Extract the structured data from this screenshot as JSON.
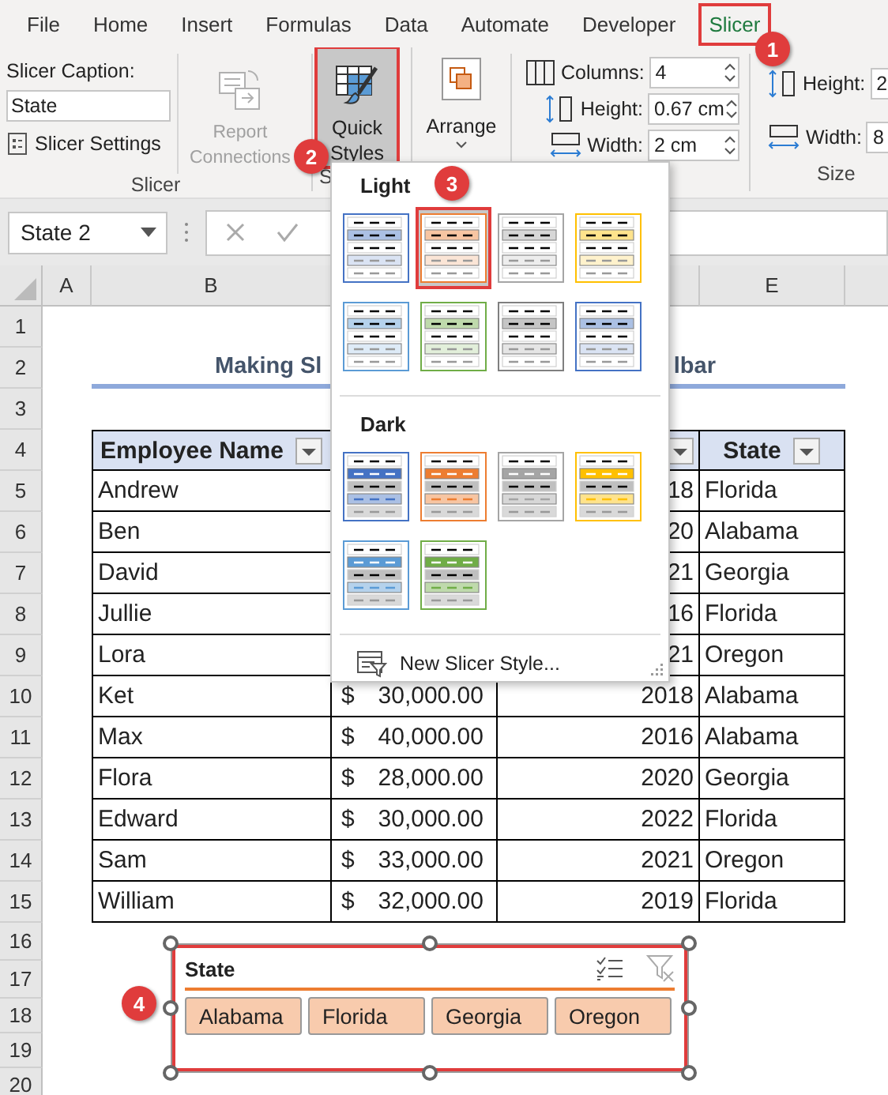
{
  "tabs": [
    {
      "label": "File",
      "selected": false,
      "highlighted": false
    },
    {
      "label": "Home",
      "selected": false,
      "highlighted": false
    },
    {
      "label": "Insert",
      "selected": false,
      "highlighted": false
    },
    {
      "label": "Formulas",
      "selected": false,
      "highlighted": false
    },
    {
      "label": "Data",
      "selected": false,
      "highlighted": false
    },
    {
      "label": "Automate",
      "selected": false,
      "highlighted": false
    },
    {
      "label": "Developer",
      "selected": false,
      "highlighted": false
    },
    {
      "label": "Slicer",
      "selected": true,
      "highlighted": true
    }
  ],
  "ribbon": {
    "slicer_group": {
      "caption_label": "Slicer Caption:",
      "caption_value": "State",
      "settings_button": "Slicer Settings",
      "report_button": {
        "lines": [
          "Report",
          "Connections"
        ],
        "disabled": true
      },
      "group_label": "Slicer"
    },
    "styles_group": {
      "quick_styles": {
        "lines": [
          "Quick",
          "Styles"
        ],
        "pressed": true,
        "highlighted": true
      },
      "group_label": "S"
    },
    "arrange_button": {
      "label": "Arrange"
    },
    "fields": [
      {
        "kind": "columns",
        "label": "Columns:",
        "value": "4"
      },
      {
        "kind": "height",
        "label": "Height:",
        "value": "0.67 cm"
      },
      {
        "kind": "width",
        "label": "Width:",
        "value": "2 cm"
      }
    ],
    "size_group": {
      "fields": [
        {
          "kind": "height",
          "label": "Height:",
          "value": "2"
        },
        {
          "kind": "width",
          "label": "Width:",
          "value": "8"
        }
      ],
      "group_label": "Size"
    }
  },
  "formula_bar": {
    "name_box": "State 2"
  },
  "gallery": {
    "sections": [
      {
        "title": "Light",
        "styles": [
          {
            "kind": "light",
            "color": "#4472c4",
            "selected": false,
            "highlighted": false
          },
          {
            "kind": "light",
            "color": "#ed7d31",
            "selected": true,
            "highlighted": true
          },
          {
            "kind": "light",
            "color": "#a5a5a5",
            "selected": false,
            "highlighted": false
          },
          {
            "kind": "light",
            "color": "#ffc000",
            "selected": false,
            "highlighted": false
          },
          {
            "kind": "light",
            "color": "#5b9bd5",
            "selected": false,
            "highlighted": false
          },
          {
            "kind": "light",
            "color": "#70ad47",
            "selected": false,
            "highlighted": false
          },
          {
            "kind": "light",
            "color": "#7f7f7f",
            "selected": false,
            "highlighted": false
          },
          {
            "kind": "light",
            "color": "#4472c4",
            "selected": false,
            "highlighted": false
          }
        ]
      },
      {
        "title": "Dark",
        "styles": [
          {
            "kind": "dark",
            "color": "#4472c4",
            "selected": false,
            "highlighted": false
          },
          {
            "kind": "dark",
            "color": "#ed7d31",
            "selected": false,
            "highlighted": false
          },
          {
            "kind": "dark",
            "color": "#a5a5a5",
            "selected": false,
            "highlighted": false
          },
          {
            "kind": "dark",
            "color": "#ffc000",
            "selected": false,
            "highlighted": false
          },
          {
            "kind": "dark",
            "color": "#5b9bd5",
            "selected": false,
            "highlighted": false
          },
          {
            "kind": "dark",
            "color": "#70ad47",
            "selected": false,
            "highlighted": false
          }
        ]
      }
    ],
    "footer": "New Slicer Style..."
  },
  "sheet": {
    "column_headers": [
      "A",
      "B",
      "E"
    ],
    "row_numbers": [
      "1",
      "2",
      "3",
      "4",
      "5",
      "6",
      "7",
      "8",
      "9",
      "10",
      "11",
      "12",
      "13",
      "14",
      "15",
      "16",
      "17",
      "18",
      "19",
      "20"
    ],
    "title_left": "Making Sl",
    "title_right": "lbar",
    "table": {
      "columns": [
        {
          "label": "Employee Name",
          "filter": true
        },
        {},
        {
          "filter": true
        },
        {
          "label": "State",
          "filter": true
        }
      ],
      "rows": [
        {
          "name": "Andrew",
          "year": "18",
          "state": "Florida"
        },
        {
          "name": "Ben",
          "year": "20",
          "state": "Alabama"
        },
        {
          "name": "David",
          "year": "21",
          "state": "Georgia"
        },
        {
          "name": "Jullie",
          "year": "16",
          "state": "Florida"
        },
        {
          "name": "Lora",
          "year": "21",
          "state": "Oregon"
        },
        {
          "name": "Ket",
          "currency": "$",
          "amount": "30,000.00",
          "year": "2018",
          "state": "Alabama"
        },
        {
          "name": "Max",
          "currency": "$",
          "amount": "40,000.00",
          "year": "2016",
          "state": "Alabama"
        },
        {
          "name": "Flora",
          "currency": "$",
          "amount": "28,000.00",
          "year": "2020",
          "state": "Georgia"
        },
        {
          "name": "Edward",
          "currency": "$",
          "amount": "30,000.00",
          "year": "2022",
          "state": "Florida"
        },
        {
          "name": "Sam",
          "currency": "$",
          "amount": "33,000.00",
          "year": "2021",
          "state": "Oregon"
        },
        {
          "name": "William",
          "currency": "$",
          "amount": "32,000.00",
          "year": "2019",
          "state": "Florida"
        }
      ]
    }
  },
  "slicer": {
    "title": "State",
    "highlighted": true,
    "items": [
      {
        "label": "Alabama",
        "selected": true
      },
      {
        "label": "Florida",
        "selected": true
      },
      {
        "label": "Georgia",
        "selected": true
      },
      {
        "label": "Oregon",
        "selected": true
      }
    ]
  },
  "callouts": [
    {
      "label": "1"
    },
    {
      "label": "2"
    },
    {
      "label": "3"
    },
    {
      "label": "4"
    }
  ]
}
